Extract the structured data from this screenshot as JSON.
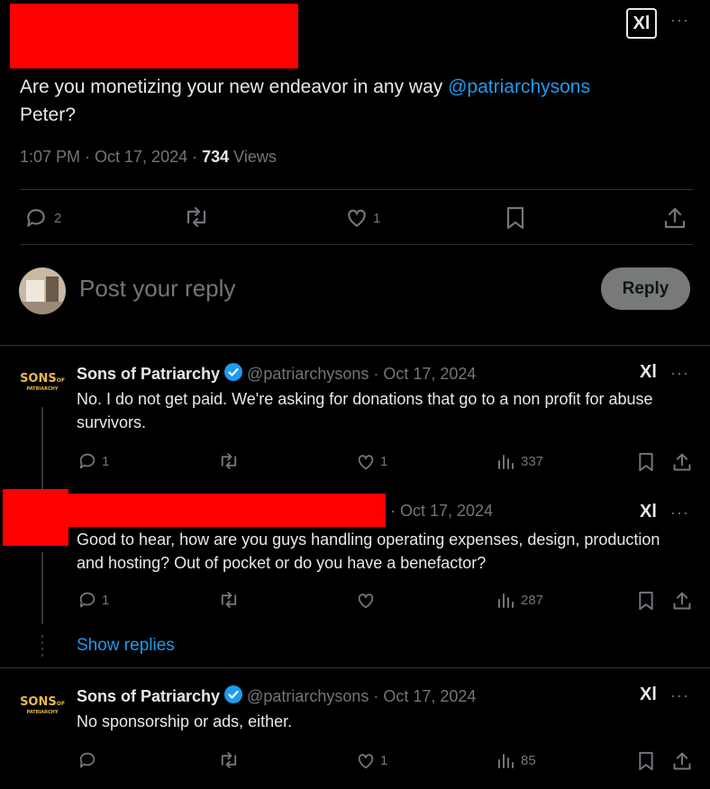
{
  "main_tweet": {
    "text_prefix": "Are you monetizing your new endeavor in any way ",
    "mention": "@patriarchysons",
    "text_suffix": "Peter?",
    "time": "1:07 PM · Oct 17, 2024 · ",
    "views_count": "734",
    "views_label": " Views",
    "replies": "2",
    "likes": "1"
  },
  "reply_box": {
    "placeholder": "Post your reply",
    "button": "Reply"
  },
  "replies": [
    {
      "avatar_text": "SONS",
      "avatar_small": "OF",
      "avatar_sub": "PATRIARCHY",
      "name": "Sons of Patriarchy",
      "handle": "@patriarchysons",
      "date": " · Oct 17, 2024",
      "text": "No. I do not get paid. We're asking for donations that go to a non profit for abuse survivors.",
      "replies": "1",
      "likes": "1",
      "views": "337"
    },
    {
      "date": "· Oct 17, 2024",
      "text": "Good to hear, how are you guys handling operating expenses, design, production and hosting? Out of pocket or do you have a benefactor?",
      "replies": "1",
      "likes": "",
      "views": "287",
      "show_replies": "Show replies"
    },
    {
      "avatar_text": "SONS",
      "avatar_small": "OF",
      "avatar_sub": "PATRIARCHY",
      "name": "Sons of Patriarchy",
      "handle": "@patriarchysons",
      "date": " · Oct 17, 2024",
      "text": "No sponsorship or ads, either.",
      "replies": "",
      "likes": "1",
      "views": "85"
    }
  ],
  "icons": {
    "grok": "Xl",
    "more": "···"
  },
  "colors": {
    "background": "#000000",
    "accent": "#1d9bf0",
    "muted": "#71767b",
    "redaction": "#ff0000",
    "reply_button": "#787a7a"
  }
}
